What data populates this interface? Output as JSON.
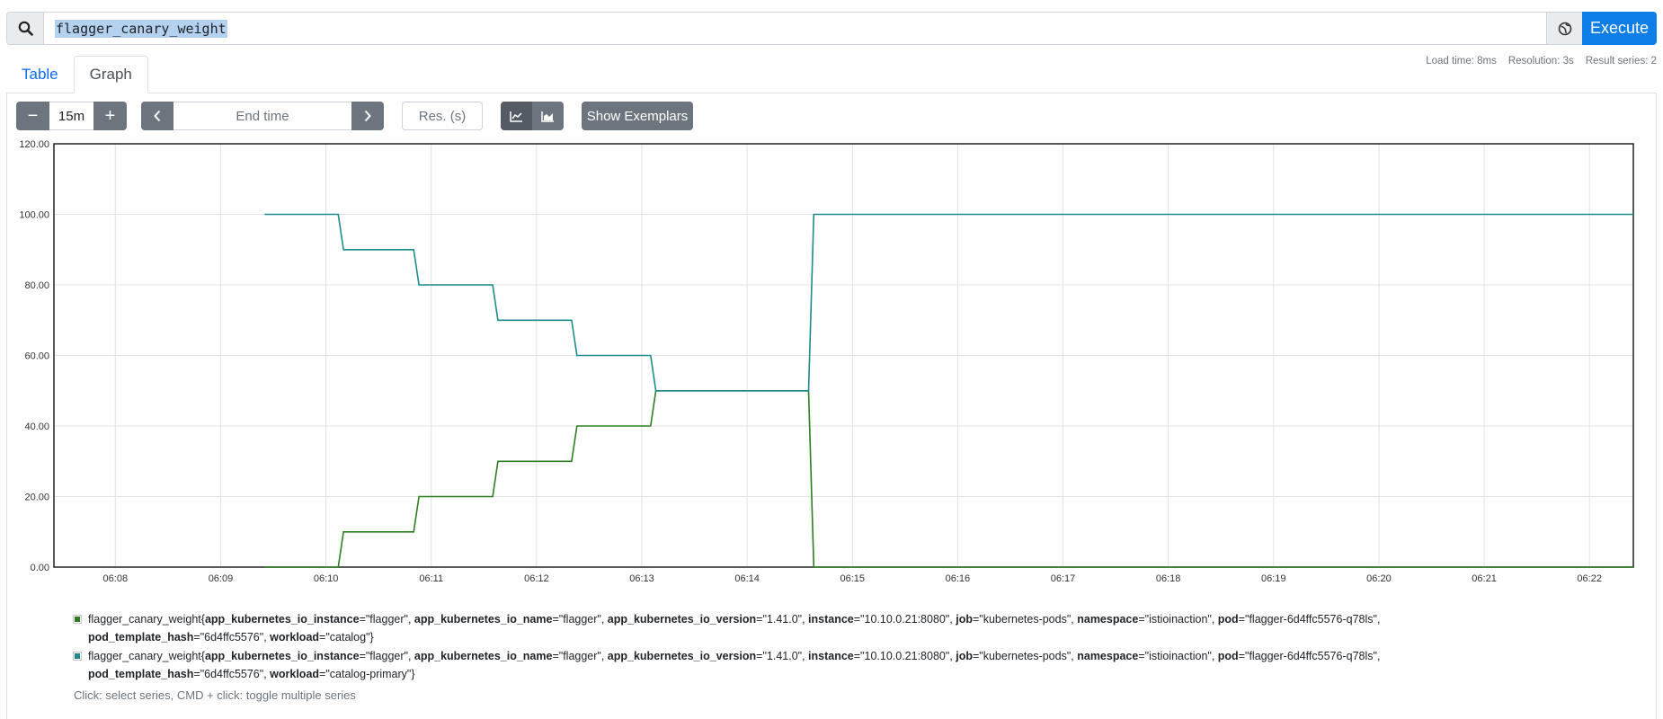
{
  "query": {
    "expression": "flagger_canary_weight",
    "execute_label": "Execute"
  },
  "stats": {
    "load_time": "Load time: 8ms",
    "resolution": "Resolution: 3s",
    "result_series": "Result series: 2"
  },
  "tabs": [
    {
      "label": "Table",
      "active": false
    },
    {
      "label": "Graph",
      "active": true
    }
  ],
  "controls": {
    "range": "15m",
    "minus": "−",
    "plus": "+",
    "end_time_placeholder": "End time",
    "resolution_placeholder": "Res. (s)",
    "exemplars_label": "Show Exemplars"
  },
  "chart_data": {
    "type": "line",
    "x_ticks": [
      "06:08",
      "06:09",
      "06:10",
      "06:11",
      "06:12",
      "06:13",
      "06:14",
      "06:15",
      "06:16",
      "06:17",
      "06:18",
      "06:19",
      "06:20",
      "06:21",
      "06:22"
    ],
    "y_ticks": [
      "0.00",
      "20.00",
      "40.00",
      "60.00",
      "80.00",
      "100.00",
      "120.00"
    ],
    "ylim": [
      0,
      120
    ],
    "xlim": [
      "06:07:25",
      "06:22:25"
    ],
    "grid": true,
    "series": [
      {
        "color": "#2e7d23",
        "x": [
          "06:09:25",
          "06:10:07",
          "06:10:10",
          "06:10:50",
          "06:10:53",
          "06:11:35",
          "06:11:38",
          "06:12:20",
          "06:12:23",
          "06:13:05",
          "06:13:08",
          "06:14:35",
          "06:14:38",
          "06:22:25"
        ],
        "values": [
          0,
          0,
          10,
          10,
          20,
          20,
          30,
          30,
          40,
          40,
          50,
          50,
          0,
          0
        ]
      },
      {
        "color": "#1c8c8c",
        "x": [
          "06:09:25",
          "06:10:07",
          "06:10:10",
          "06:10:50",
          "06:10:53",
          "06:11:35",
          "06:11:38",
          "06:12:20",
          "06:12:23",
          "06:13:05",
          "06:13:08",
          "06:14:35",
          "06:14:38",
          "06:22:25"
        ],
        "values": [
          100,
          100,
          90,
          90,
          80,
          80,
          70,
          70,
          60,
          60,
          50,
          50,
          100,
          100
        ]
      }
    ]
  },
  "legend": [
    {
      "color": "#2e7d23",
      "segments": [
        [
          "flagger_canary_weight{",
          ""
        ],
        [
          "",
          "app_kubernetes_io_instance"
        ],
        [
          "=\"flagger\", ",
          ""
        ],
        [
          "",
          "app_kubernetes_io_name"
        ],
        [
          "=\"flagger\", ",
          ""
        ],
        [
          "",
          "app_kubernetes_io_version"
        ],
        [
          "=\"1.41.0\", ",
          ""
        ],
        [
          "",
          "instance"
        ],
        [
          "=\"10.10.0.21:8080\", ",
          ""
        ],
        [
          "",
          "job"
        ],
        [
          "=\"kubernetes-pods\", ",
          ""
        ],
        [
          "",
          "namespace"
        ],
        [
          "=\"istioinaction\", ",
          ""
        ],
        [
          "",
          "pod"
        ],
        [
          "=\"flagger-6d4ffc5576-q78ls\",",
          ""
        ]
      ],
      "segments2": [
        [
          "",
          "pod_template_hash"
        ],
        [
          "=\"6d4ffc5576\", ",
          ""
        ],
        [
          "",
          "workload"
        ],
        [
          "=\"catalog\"}",
          ""
        ]
      ]
    },
    {
      "color": "#1c8c8c",
      "segments": [
        [
          "flagger_canary_weight{",
          ""
        ],
        [
          "",
          "app_kubernetes_io_instance"
        ],
        [
          "=\"flagger\", ",
          ""
        ],
        [
          "",
          "app_kubernetes_io_name"
        ],
        [
          "=\"flagger\", ",
          ""
        ],
        [
          "",
          "app_kubernetes_io_version"
        ],
        [
          "=\"1.41.0\", ",
          ""
        ],
        [
          "",
          "instance"
        ],
        [
          "=\"10.10.0.21:8080\", ",
          ""
        ],
        [
          "",
          "job"
        ],
        [
          "=\"kubernetes-pods\", ",
          ""
        ],
        [
          "",
          "namespace"
        ],
        [
          "=\"istioinaction\", ",
          ""
        ],
        [
          "",
          "pod"
        ],
        [
          "=\"flagger-6d4ffc5576-q78ls\",",
          ""
        ]
      ],
      "segments2": [
        [
          "",
          "pod_template_hash"
        ],
        [
          "=\"6d4ffc5576\", ",
          ""
        ],
        [
          "",
          "workload"
        ],
        [
          "=\"catalog-primary\"}",
          ""
        ]
      ]
    }
  ],
  "hint": "Click: select series, CMD + click: toggle multiple series"
}
